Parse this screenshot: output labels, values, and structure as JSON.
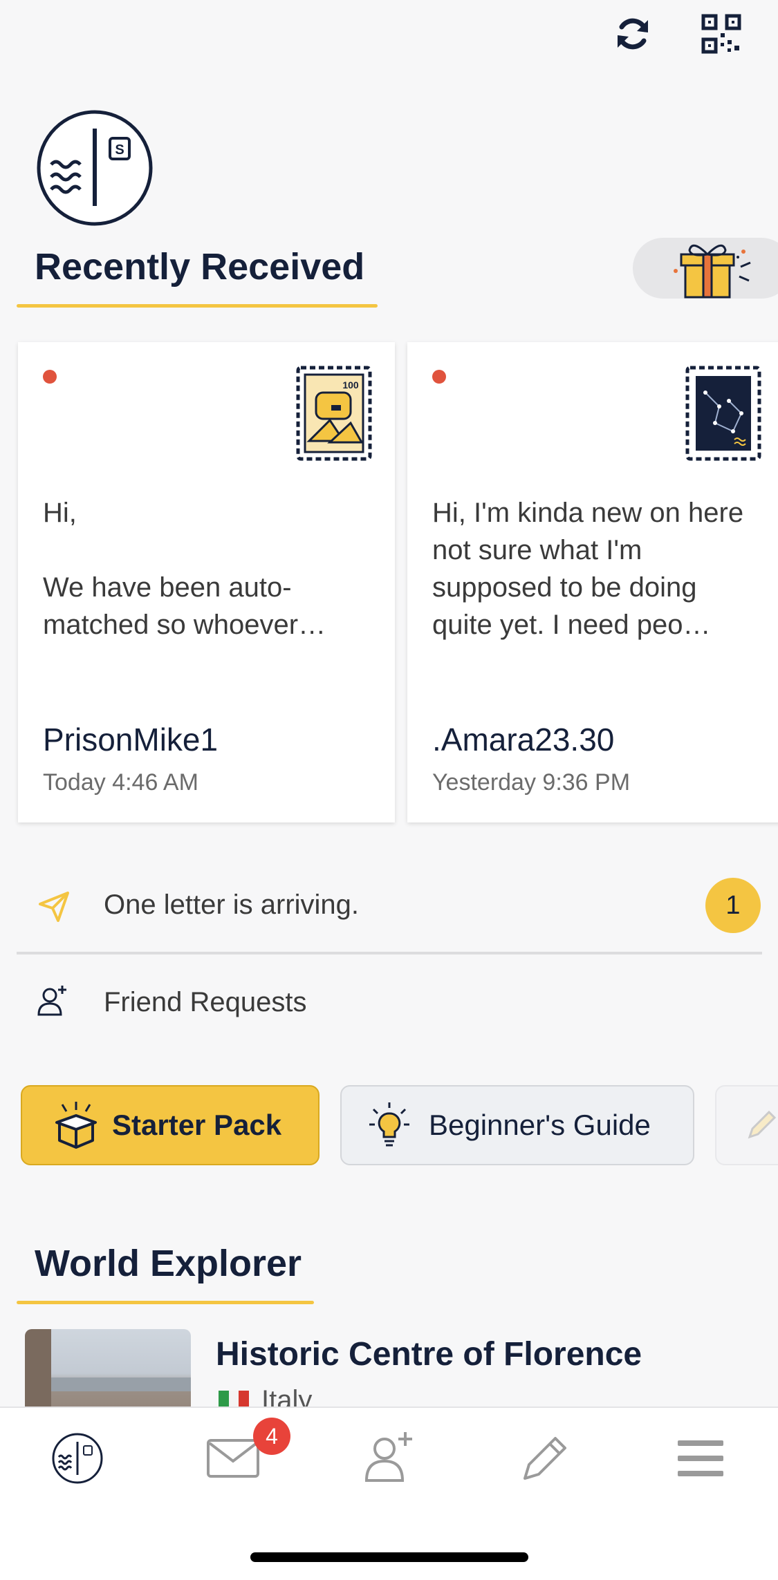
{
  "top_bar": {
    "refresh_icon": "refresh-icon",
    "qr_icon": "qr-code-icon"
  },
  "recently_received": {
    "title": "Recently Received",
    "letters": [
      {
        "preview": "Hi,\n\nWe have been auto-matched so whoever…",
        "sender": "PrisonMike1",
        "time": "Today 4:46 AM",
        "stamp": "mailbox-stamp",
        "unread": true
      },
      {
        "preview": "Hi, I'm kinda new on here not sure what I'm supposed to be doing quite yet. I need peo…",
        "sender": ".Amara23.30",
        "time": "Yesterday 9:36 PM",
        "stamp": "constellation-stamp",
        "unread": true
      }
    ]
  },
  "arriving": {
    "text": "One letter is arriving.",
    "count": "1"
  },
  "friend_requests": {
    "label": "Friend Requests"
  },
  "chips": {
    "starter_pack": "Starter Pack",
    "beginners_guide": "Beginner's Guide"
  },
  "world_explorer": {
    "title": "World Explorer",
    "item_title": "Historic Centre of Florence",
    "item_country": "Italy"
  },
  "bottom_nav": {
    "mail_badge": "4"
  },
  "colors": {
    "accent": "#f4c542",
    "navy": "#15203a",
    "unread_dot": "#e0533d",
    "badge": "#e8433a"
  }
}
